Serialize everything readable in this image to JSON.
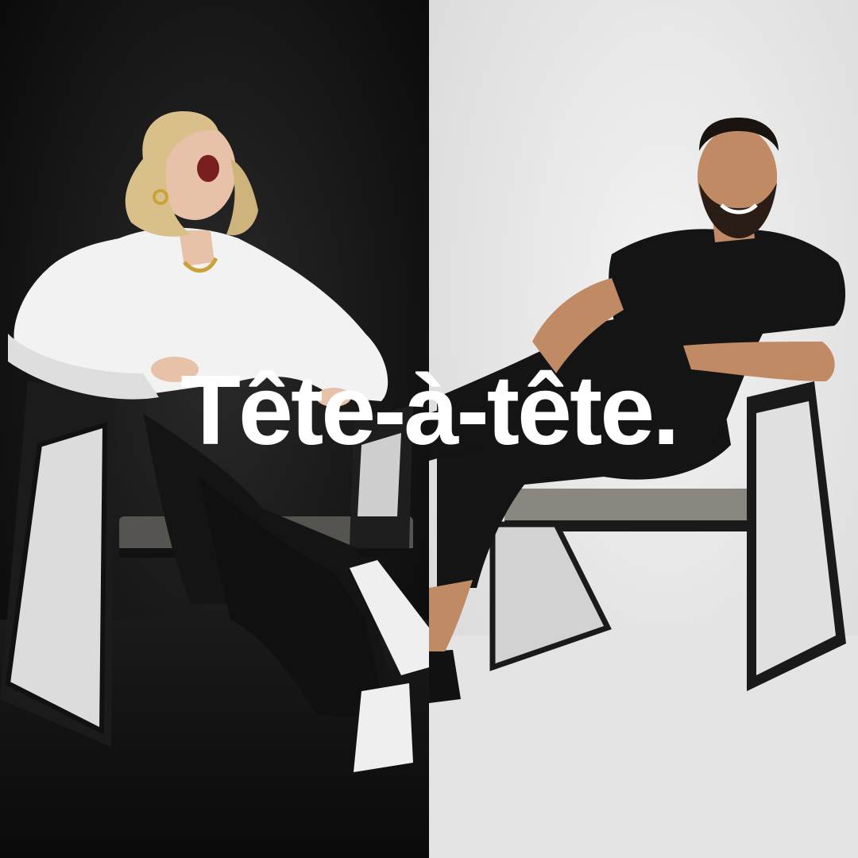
{
  "title": "Tête-à-tête.",
  "colors": {
    "left_background": "#0f0f0f",
    "right_background": "#e8e8e8",
    "title_text": "#ffffff",
    "shirt_white": "#f2f2f2",
    "outfit_black": "#141414"
  }
}
